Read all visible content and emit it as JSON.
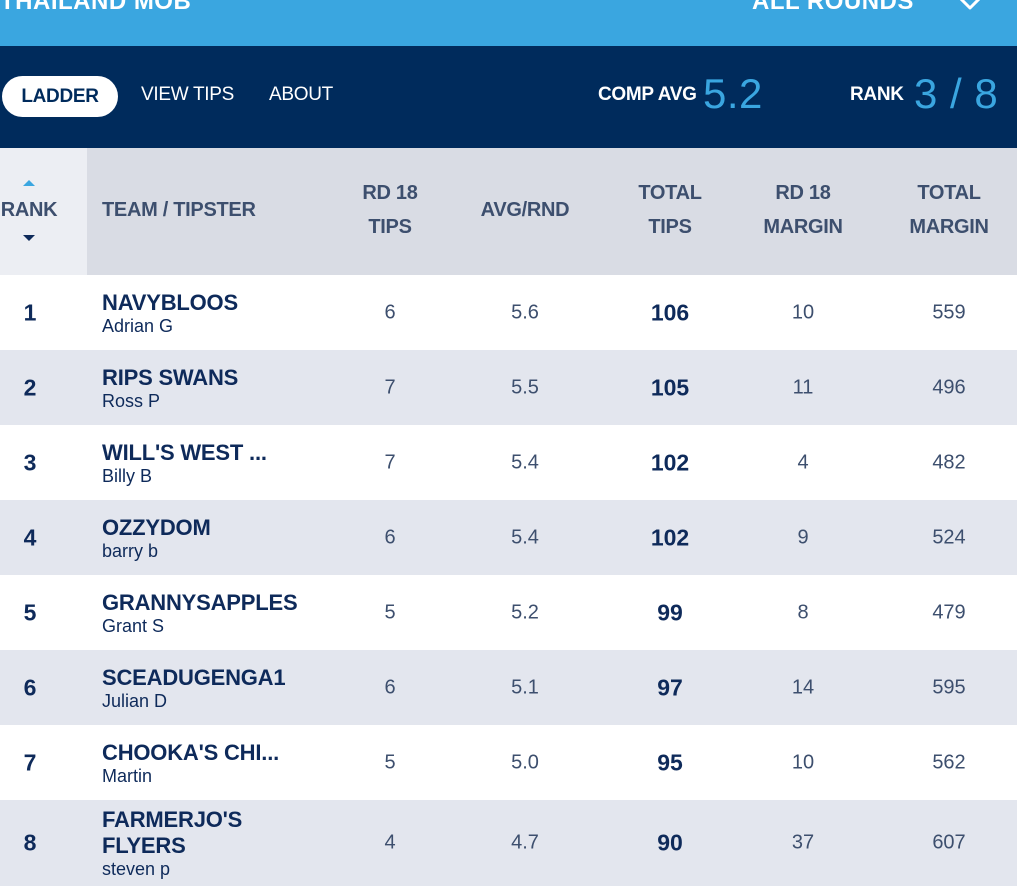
{
  "header": {
    "competition_name": "THAILAND MOB",
    "round_selector": "ALL ROUNDS"
  },
  "nav": {
    "tabs": [
      "LADDER",
      "VIEW TIPS",
      "ABOUT"
    ],
    "comp_avg_label": "COMP AVG",
    "comp_avg_value": "5.2",
    "rank_label": "RANK",
    "rank_value": "3 / 8"
  },
  "table": {
    "headers": {
      "rank": "RANK",
      "team": "TEAM / TIPSTER",
      "rd_tips_1": "RD 18",
      "rd_tips_2": "TIPS",
      "avg": "AVG/RND",
      "total_tips_1": "TOTAL",
      "total_tips_2": "TIPS",
      "rd_margin_1": "RD 18",
      "rd_margin_2": "MARGIN",
      "total_margin_1": "TOTAL",
      "total_margin_2": "MARGIN"
    },
    "rows": [
      {
        "rank": "1",
        "team": "NAVYBLOOS",
        "tipster": "Adrian G",
        "rd_tips": "6",
        "avg": "5.6",
        "total_tips": "106",
        "rd_margin": "10",
        "total_margin": "559"
      },
      {
        "rank": "2",
        "team": "RIPS SWANS",
        "tipster": "Ross P",
        "rd_tips": "7",
        "avg": "5.5",
        "total_tips": "105",
        "rd_margin": "11",
        "total_margin": "496"
      },
      {
        "rank": "3",
        "team": "WILL'S WEST ...",
        "tipster": "Billy B",
        "rd_tips": "7",
        "avg": "5.4",
        "total_tips": "102",
        "rd_margin": "4",
        "total_margin": "482"
      },
      {
        "rank": "4",
        "team": "OZZYDOM",
        "tipster": "barry b",
        "rd_tips": "6",
        "avg": "5.4",
        "total_tips": "102",
        "rd_margin": "9",
        "total_margin": "524"
      },
      {
        "rank": "5",
        "team": "GRANNYSAPPLES",
        "tipster": "Grant S",
        "rd_tips": "5",
        "avg": "5.2",
        "total_tips": "99",
        "rd_margin": "8",
        "total_margin": "479"
      },
      {
        "rank": "6",
        "team": "SCEADUGENGA1",
        "tipster": "Julian D",
        "rd_tips": "6",
        "avg": "5.1",
        "total_tips": "97",
        "rd_margin": "14",
        "total_margin": "595"
      },
      {
        "rank": "7",
        "team": "CHOOKA'S CHI...",
        "tipster": "Martin",
        "rd_tips": "5",
        "avg": "5.0",
        "total_tips": "95",
        "rd_margin": "10",
        "total_margin": "562"
      },
      {
        "rank": "8",
        "team": "FARMERJO'S FLYERS",
        "tipster": "steven p",
        "rd_tips": "4",
        "avg": "4.7",
        "total_tips": "90",
        "rd_margin": "37",
        "total_margin": "607"
      }
    ]
  },
  "colors": {
    "topbar": "#3aa6e0",
    "navbar": "#002b5c",
    "accent": "#3aa6e0",
    "header_bg": "#d9dce4",
    "row_alt": "#e3e6ee"
  },
  "icons": {
    "round_selector": "chevron-down-icon",
    "sort_asc": "sort-up-icon",
    "sort_desc": "sort-down-icon"
  }
}
